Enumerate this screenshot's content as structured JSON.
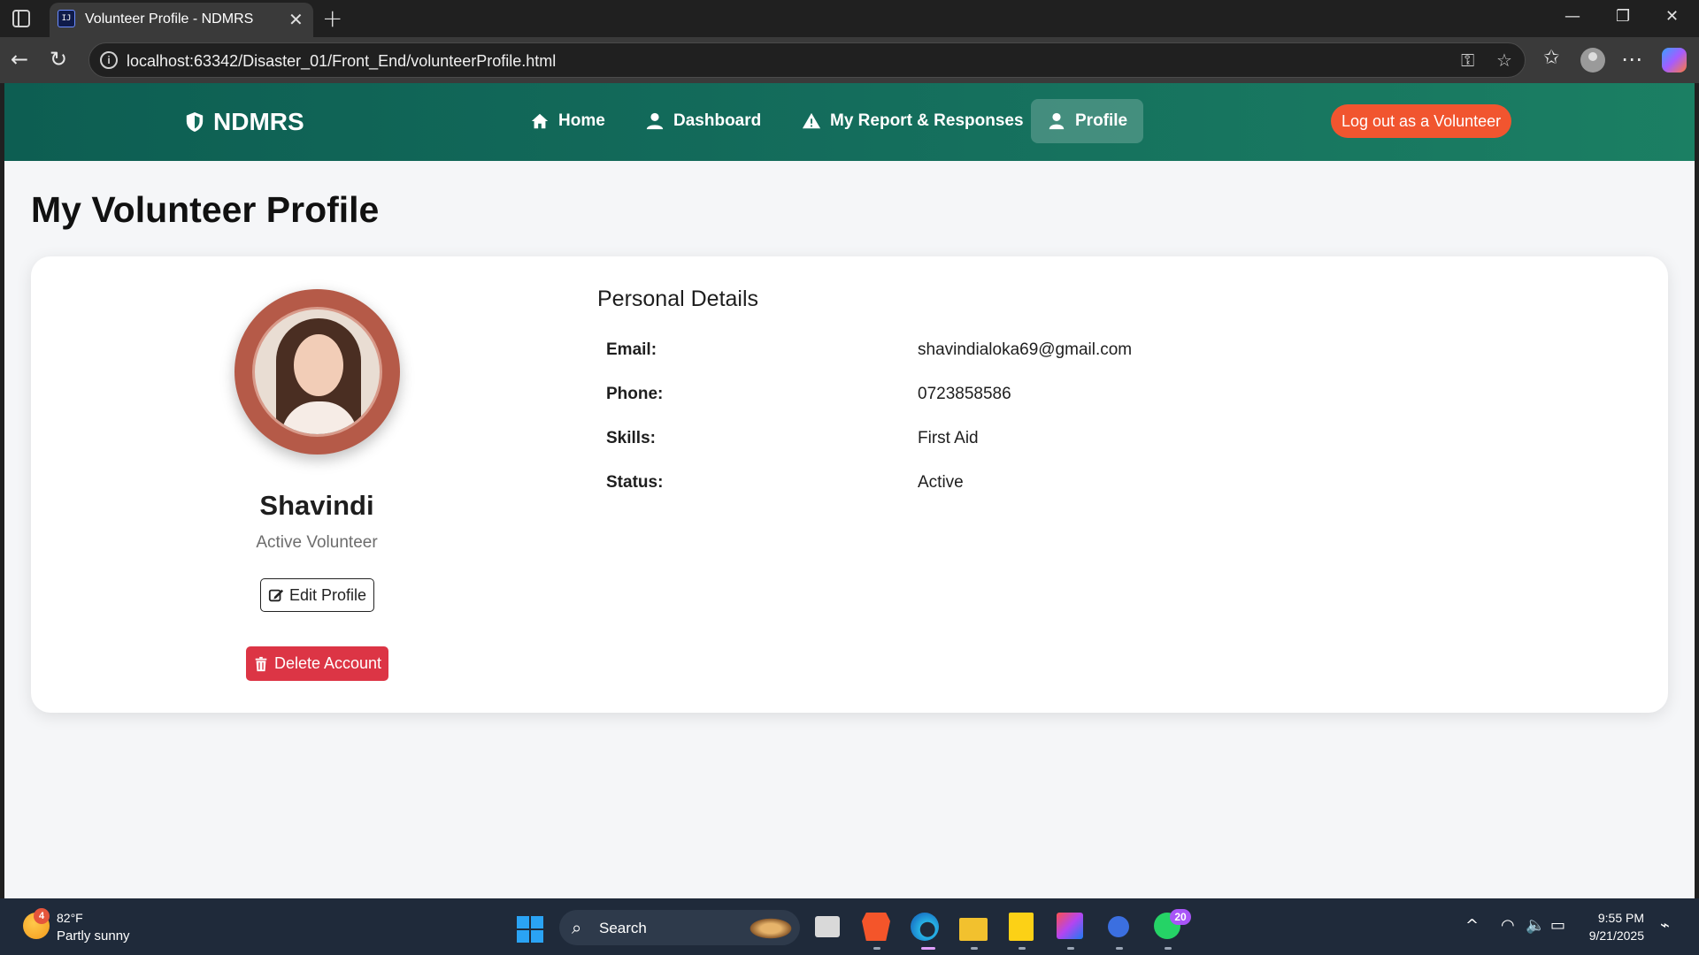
{
  "browser": {
    "tab_title": "Volunteer Profile - NDMRS",
    "tab_favicon_text": "IJ",
    "url": "localhost:63342/Disaster_01/Front_End/volunteerProfile.html"
  },
  "navbar": {
    "brand": "NDMRS",
    "items": [
      {
        "label": "Home",
        "icon": "home-icon"
      },
      {
        "label": "Dashboard",
        "icon": "user-icon"
      },
      {
        "label": "My Report & Responses",
        "icon": "warning-icon"
      },
      {
        "label": "Profile",
        "icon": "user-icon",
        "active": true
      }
    ],
    "logout_label": "Log out as a Volunteer"
  },
  "page": {
    "title": "My Volunteer Profile"
  },
  "profile": {
    "name": "Shavindi",
    "role": "Active Volunteer",
    "edit_label": "Edit Profile",
    "delete_label": "Delete Account"
  },
  "details": {
    "title": "Personal Details",
    "rows": [
      {
        "label": "Email:",
        "value": "shavindialoka69@gmail.com"
      },
      {
        "label": "Phone:",
        "value": "0723858586"
      },
      {
        "label": "Skills:",
        "value": "First Aid"
      },
      {
        "label": "Status:",
        "value": "Active"
      }
    ]
  },
  "taskbar": {
    "weather_badge": "4",
    "weather_temp": "82°F",
    "weather_desc": "Partly sunny",
    "search_label": "Search",
    "whatsapp_badge": "20",
    "time": "9:55 PM",
    "date": "9/21/2025"
  },
  "colors": {
    "navbar_start": "#0d5e52",
    "navbar_end": "#1b7f63",
    "logout": "#f1552f",
    "delete": "#dc3545",
    "photo_ring": "#b55a48"
  }
}
